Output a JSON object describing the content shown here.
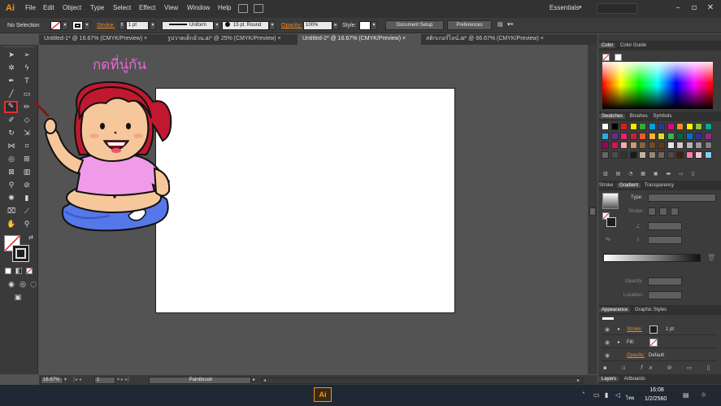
{
  "app": {
    "logo": "Ai"
  },
  "menu": [
    "File",
    "Edit",
    "Object",
    "Type",
    "Select",
    "Effect",
    "View",
    "Window",
    "Help"
  ],
  "workspace": "Essentials",
  "control_bar": {
    "selection": "No Selection",
    "stroke_label": "Stroke:",
    "stroke_weight": "1 pt",
    "profile": "Uniform",
    "brush": "15 pt. Round",
    "opacity_label": "Opacity:",
    "opacity": "100%",
    "style_label": "Style:",
    "document_setup": "Document Setup",
    "preferences": "Preferences"
  },
  "tabs": [
    {
      "label": "Untitled-1* @ 16.67% (CMYK/Preview)",
      "close": "×"
    },
    {
      "label": "รูปวาดเด็กอ้วน.ai* @ 25% (CMYK/Preview)",
      "close": "×"
    },
    {
      "label": "Untitled-2* @ 16.67% (CMYK/Preview)",
      "close": "×"
    },
    {
      "label": "สติกเกอร์ไลน์.ai* @ 66.67% (CMYK/Preview)",
      "close": "×"
    }
  ],
  "annotation": "กดที่นู่กัน",
  "status_bar": {
    "zoom": "16.67%",
    "artboard": "1",
    "tool": "Paintbrush"
  },
  "panels": {
    "color": {
      "tabs": [
        "Color",
        "Color Guide"
      ]
    },
    "swatches": {
      "tabs": [
        "Swatches",
        "Brushes",
        "Symbols"
      ]
    },
    "gradient": {
      "tabs": [
        "Stroke",
        "Gradient",
        "Transparency"
      ],
      "type_label": "Type:",
      "stroke_label": "Stroke:",
      "opacity_label": "Opacity:",
      "location_label": "Location:"
    },
    "appearance": {
      "tabs": [
        "Appearance",
        "Graphic Styles"
      ],
      "rows": [
        {
          "label": "Stroke:",
          "value": "1 pt"
        },
        {
          "label": "Fill:",
          "value": ""
        },
        {
          "label": "Opacity:",
          "value": "Default"
        }
      ],
      "fx": "fx"
    },
    "layers": {
      "tabs": [
        "Layers",
        "Artboards"
      ]
    }
  },
  "taskbar": {
    "app": "Ai",
    "lang": "ไทย",
    "time": "16:08",
    "date": "1/2/2560"
  },
  "colors": {
    "accent": "#f7931e",
    "highlight": "#e63030",
    "pink_text": "#e66ad2"
  }
}
